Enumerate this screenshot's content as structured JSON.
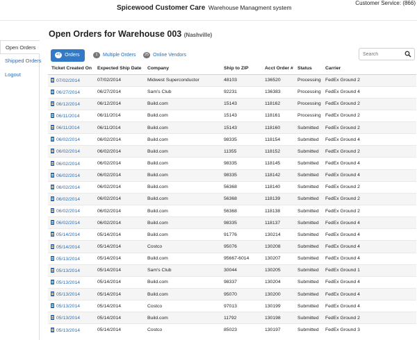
{
  "header": {
    "brand_name": "Spicewood Customer Care",
    "brand_sub": "Warehouse Managment system",
    "customer_service": "Customer Service: (866)"
  },
  "sidebar": {
    "items": [
      {
        "label": "Open Orders"
      },
      {
        "label": "Shipped Orders"
      },
      {
        "label": "Logout"
      }
    ]
  },
  "page": {
    "title": "Open Orders for Warehouse 003",
    "location": "(Nashville)"
  },
  "tabs": [
    {
      "count": "47",
      "label": "Orders"
    },
    {
      "count": "1",
      "label": "Multiple Orders"
    },
    {
      "count": "25",
      "label": "Online Vendors"
    }
  ],
  "search": {
    "placeholder": "Search"
  },
  "colors": {
    "link": "#2a6bb5",
    "active_pill": "#3379c5"
  },
  "table": {
    "columns": [
      "Ticket Created On",
      "Expected Ship Date",
      "Company",
      "Ship to ZIP",
      "Acct Order #",
      "Status",
      "Carrier"
    ],
    "rows": [
      [
        "07/02/2014",
        "07/02/2014",
        "Midwest Superconductor",
        "48103",
        "136520",
        "Processing",
        "FedEx Ground 2"
      ],
      [
        "06/27/2014",
        "06/27/2014",
        "Sam's Club",
        "92231",
        "136383",
        "Processing",
        "FedEx Ground 4"
      ],
      [
        "06/12/2014",
        "06/12/2014",
        "Build.com",
        "15143",
        "118162",
        "Processing",
        "FedEx Ground 2"
      ],
      [
        "06/11/2014",
        "06/11/2014",
        "Build.com",
        "15143",
        "118161",
        "Processing",
        "FedEx Ground 2"
      ],
      [
        "06/11/2014",
        "06/11/2014",
        "Build.com",
        "15143",
        "118160",
        "Submitted",
        "FedEx Ground 2"
      ],
      [
        "06/02/2014",
        "06/02/2014",
        "Build.com",
        "98335",
        "118154",
        "Submitted",
        "FedEx Ground 4"
      ],
      [
        "06/02/2014",
        "06/02/2014",
        "Build.com",
        "11355",
        "118152",
        "Submitted",
        "FedEx Ground 2"
      ],
      [
        "06/02/2014",
        "06/02/2014",
        "Build.com",
        "98335",
        "118145",
        "Submitted",
        "FedEx Ground 4"
      ],
      [
        "06/02/2014",
        "06/02/2014",
        "Build.com",
        "98335",
        "118142",
        "Submitted",
        "FedEx Ground 4"
      ],
      [
        "06/02/2014",
        "06/02/2014",
        "Build.com",
        "56368",
        "118140",
        "Submitted",
        "FedEx Ground 2"
      ],
      [
        "06/02/2014",
        "06/02/2014",
        "Build.com",
        "56368",
        "118139",
        "Submitted",
        "FedEx Ground 2"
      ],
      [
        "06/02/2014",
        "06/02/2014",
        "Build.com",
        "56368",
        "118138",
        "Submitted",
        "FedEx Ground 2"
      ],
      [
        "06/02/2014",
        "06/02/2014",
        "Build.com",
        "98335",
        "118137",
        "Submitted",
        "FedEx Ground 4"
      ],
      [
        "05/14/2014",
        "05/14/2014",
        "Build.com",
        "91776",
        "130214",
        "Submitted",
        "FedEx Ground 4"
      ],
      [
        "05/14/2014",
        "05/14/2014",
        "Costco",
        "95076",
        "130208",
        "Submitted",
        "FedEx Ground 4"
      ],
      [
        "05/13/2014",
        "05/14/2014",
        "Build.com",
        "95667-6014",
        "130207",
        "Submitted",
        "FedEx Ground 4"
      ],
      [
        "05/13/2014",
        "05/14/2014",
        "Sam's Club",
        "30044",
        "130205",
        "Submitted",
        "FedEx Ground 1"
      ],
      [
        "05/13/2014",
        "05/14/2014",
        "Build.com",
        "98337",
        "130204",
        "Submitted",
        "FedEx Ground 4"
      ],
      [
        "05/13/2014",
        "05/14/2014",
        "Build.com",
        "95070",
        "130200",
        "Submitted",
        "FedEx Ground 4"
      ],
      [
        "05/13/2014",
        "05/14/2014",
        "Costco",
        "97013",
        "130199",
        "Submitted",
        "FedEx Ground 4"
      ],
      [
        "05/13/2014",
        "05/14/2014",
        "Build.com",
        "11792",
        "130198",
        "Submitted",
        "FedEx Ground 2"
      ],
      [
        "05/13/2014",
        "05/14/2014",
        "Costco",
        "85023",
        "130197",
        "Submitted",
        "FedEx Ground 3"
      ]
    ]
  }
}
